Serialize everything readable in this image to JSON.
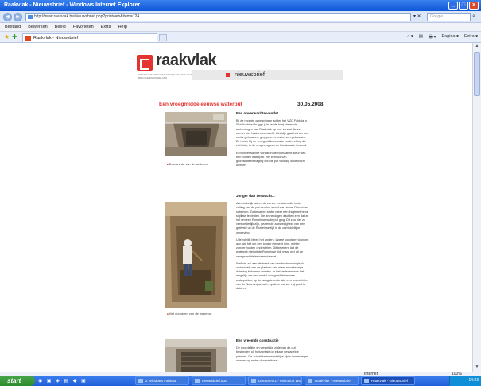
{
  "window": {
    "title": "Raakvlak - Nieuwsbrief - Windows Internet Explorer",
    "buttons": [
      "_",
      "□",
      "×"
    ]
  },
  "addressbar": {
    "back": "◄",
    "forward": "►",
    "url": "http://www.raakvlak.be/nieuwsbrief.php?printweb&item=124",
    "tools": "▾ ✕",
    "search_placeholder": "Google",
    "search_button": "⌕"
  },
  "menu": [
    "Bestand",
    "Bewerken",
    "Beeld",
    "Favorieten",
    "Extra",
    "Help"
  ],
  "tabs": {
    "active_label": "Raakvlak - Nieuwsbrief",
    "commands": [
      "⌂ ▾",
      "▤",
      "🖶 ▾",
      "Pagina ▾",
      "Extra ▾"
    ]
  },
  "site": {
    "logo_text": "raakvlak",
    "logo_subtitle": "INTERGEMEENTELIJKE DIENST ARCHEOLOGIE BRUGGE EN OMMELAND",
    "section": "nieuwsbrief"
  },
  "article": {
    "title": "Een vroegmiddeleeuwse waterput",
    "date": "30.05.2008",
    "captions": [
      "Doorsnede van de waterput",
      "Het opgraven van de waterput"
    ],
    "sections": [
      {
        "heading": "Een onverwachte vondst",
        "paragraphs": [
          "Bij de recente opgravingen achter het VZC Fabiola in Sint-Andries/Brugge (zie reeds hier) vielen de archeologen van Raakvlak op een vondst die ze eerder niet hadden verwacht. Beeldje gaat het om een reeks gebouwen, greppels en resten van gebouwen. Ze horen bij de vroegmiddeleeuwse nederzetting die zich hier, in de omgeving van de Zandstraat, bevond.",
          "Een onverwachte vondst in de voorlaatste sleuf was een houten waterput. Het behoud van grondwaterverlaging kon de put volledig onderzocht worden."
        ]
      },
      {
        "heading": "Jonger dan verwacht...",
        "paragraphs": [
          "Aanvankelijk waren de eerste vondsten die in de vulling van de put een hel somehow nieuw. Romeinse scherven. Zo bevat en ander meer een fragment terra sigillata te vinden. De archeologen dachten een dat ze het um een Romeinse waterput ging. Dit zou niet zo verwonderlijk zijn, gezien de aanwezigheid van een grafveld uit de Romeinse tijd in de onmiddellijke omgeving.",
          "Uiteindelijk bleek het anders: lagere vondsten toonden aan dat het om een jonger element ging, echter zonder houten onderdelen. Dit betekent dat de waterput niet uit de Romeinse tijd, maar wel uit de vroege middeleeuwen dateert.",
          "Wellicht zal aan de hand van dendrochronologisch onderzoek van de planken een meer nauwkeurige datering bekomen worden. In het verleden was het mogelijk om een aantal vroegmiddeleeuwse waterputten, op de aangeleverde site een overzichten van de Noorderparkwet, op deze manier vrij goed te dateren."
        ]
      },
      {
        "heading": "Een vreemde constructie",
        "paragraphs": [
          "De noordelijke en westelijke zijde van de put bestonden uit horizontale op elkaar gestapelde planken. De zuidelijke en westelijke zijde daarentegen werden op ander door verticaal"
        ]
      }
    ]
  },
  "statusbar": {
    "zone": "Internet",
    "zoom": "100%"
  },
  "taskbar": {
    "start": "start",
    "quicklaunch": "◉ ▣ ◈ ▤ ◆ ▣",
    "tasks": [
      "2 Windows Fabiola",
      "nieuwsbrief.doc",
      "Document1 - Microsoft Word",
      "Raakvlak - Nieuwsbrief",
      "Raakvlak - Nieuwsbrief"
    ],
    "clock": "14:23"
  }
}
